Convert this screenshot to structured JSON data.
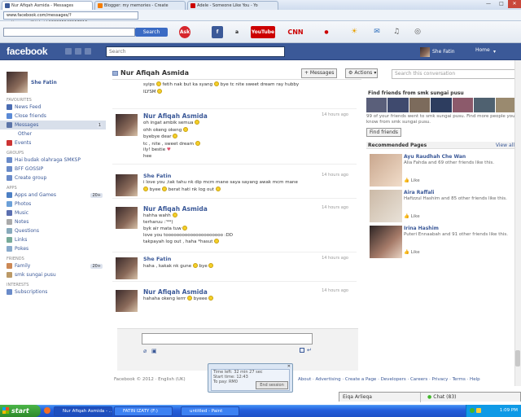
{
  "browser": {
    "tabs": [
      {
        "label": "Nur Afiqah Asmida - Messages",
        "icon_color": "#3b5998",
        "active": true
      },
      {
        "label": "Blogger: my memories - Create",
        "icon_color": "#f57d00",
        "active": false
      },
      {
        "label": "Adele - Someone Like You - Yo",
        "icon_color": "#cc0000",
        "active": false
      }
    ],
    "url": "www.facebook.com/messages/?action=read&tid=id.136305543157316",
    "search_button": "Search",
    "toolbar_icons": [
      {
        "name": "ask-icon",
        "label": "Ask",
        "color": "#d6262c"
      },
      {
        "name": "facebook-icon",
        "label": "f",
        "color": "#3b5998"
      },
      {
        "name": "amazon-icon",
        "label": "a",
        "color": "#222"
      },
      {
        "name": "youtube-icon",
        "label": "YouTube",
        "color": "#c00"
      },
      {
        "name": "cnn-icon",
        "label": "CNN",
        "color": "#c00"
      },
      {
        "name": "weather-icon",
        "label": "☀",
        "color": "#e8a000"
      },
      {
        "name": "mail-icon",
        "label": "✉",
        "color": "#2e6fbd"
      },
      {
        "name": "music-icon",
        "label": "♫",
        "color": "#555"
      }
    ]
  },
  "fb": {
    "logo": "facebook",
    "search_placeholder": "Search",
    "user_name": "She Fatin",
    "home": "Home"
  },
  "left": {
    "profile_name": "She Fatin",
    "favourites_heading": "FAVOURITES",
    "favourites": [
      {
        "label": "News Feed",
        "color": "#4a6cb3",
        "count": ""
      },
      {
        "label": "Close friends",
        "color": "#5a8ad6",
        "count": ""
      },
      {
        "label": "Messages",
        "color": "#5b74a8",
        "count": "1",
        "selected": true
      },
      {
        "label": "Other",
        "color": "",
        "count": ""
      },
      {
        "label": "Events",
        "color": "#c33",
        "count": ""
      }
    ],
    "groups_heading": "GROUPS",
    "groups": [
      {
        "label": "Hai budak olahraga SMKSP",
        "color": "#6a8bc9"
      },
      {
        "label": "BFF GOSSIP",
        "color": "#6a8bc9"
      },
      {
        "label": "Create group",
        "color": "#6a8bc9"
      }
    ],
    "apps_heading": "APPS",
    "apps": [
      {
        "label": "Apps and Games",
        "color": "#4c7fc4",
        "count": "20+"
      },
      {
        "label": "Photos",
        "color": "#6ca0d8",
        "count": ""
      },
      {
        "label": "Music",
        "color": "#5b6fb0",
        "count": ""
      },
      {
        "label": "Notes",
        "color": "#aaa",
        "count": ""
      },
      {
        "label": "Questions",
        "color": "#8ab",
        "count": ""
      },
      {
        "label": "Links",
        "color": "#7a9",
        "count": ""
      },
      {
        "label": "Pokes",
        "color": "#8ac",
        "count": ""
      }
    ],
    "friends_heading": "FRIENDS",
    "friends": [
      {
        "label": "Family",
        "color": "#c85",
        "count": "20+"
      },
      {
        "label": "smk sungai pusu",
        "color": "#b96",
        "count": ""
      }
    ],
    "interests_heading": "INTERESTS",
    "interests": [
      {
        "label": "Subscriptions",
        "color": "#6a8bc9"
      }
    ]
  },
  "conversation": {
    "title": "Nur Afiqah Asmida",
    "messages_button": "+ Messages",
    "actions_button": "Actions",
    "search_placeholder": "Search this conversation",
    "messages": [
      {
        "name": "",
        "time": "",
        "lines": [
          "syips 🙂 fetih nak but ka syang 🙂 bye tc nite sweet dream ray hubby",
          "",
          "ILYSM 🙂"
        ]
      },
      {
        "name": "Nur Afiqah Asmida",
        "time": "14 hours ago",
        "lines": [
          "oh ingat ambik semua 🙂",
          "ohh okeng okeng 🙂",
          "byebye dear 🙂",
          "tc , nite , sweet dream 🙂",
          "ily! bestie ♥",
          "hee"
        ]
      },
      {
        "name": "She Fatin",
        "time": "14 hours ago",
        "lines": [
          "i love you ,tak tahu nk dip mcm mane saya sayang awak mcm mane",
          "🙂 byee 🙂 berat hati nk log out 🙂"
        ]
      },
      {
        "name": "Nur Afiqah Asmida",
        "time": "14 hours ago",
        "lines": [
          "hahha wahh 🙂",
          "terharuu :'**)",
          "byk air mata tuw 🙂",
          "love you tooooooooooooooooooooo :DD",
          "takpayah log out , haha *hasut 🙂"
        ]
      },
      {
        "name": "She Fatin",
        "time": "14 hours ago",
        "lines": [
          "haha , kakak nk gune 🙂 bye 🙂"
        ]
      },
      {
        "name": "Nur Afiqah Asmida",
        "time": "14 hours ago",
        "lines": [
          "hahaha okeng lerrr 🙂 byeee 🙂"
        ]
      }
    ]
  },
  "right": {
    "find_friends_heading": "Find friends from smk sungai pusu",
    "find_friends_text": "99 of your friends went to smk sungai pusu. Find more people you know from smk sungai pusu.",
    "find_friends_button": "Find friends",
    "recommended_heading": "Recommended Pages",
    "view_all": "View all",
    "pages": [
      {
        "name": "Ayu Raudhah Che Wan",
        "desc": "Alia Fahda and 69 other friends like this.",
        "like": "Like"
      },
      {
        "name": "Aira Raffali",
        "desc": "Hafizzul Hashim and 85 other friends like this.",
        "like": "Like"
      },
      {
        "name": "Irina Hashim",
        "desc": "Puteri Ennaabah and 91 other friends like this.",
        "like": "Like"
      }
    ]
  },
  "footer": {
    "copyright": "Facebook © 2012 · English (UK)",
    "links": "About · Advertising · Create a Page · Developers · Careers · Privacy · Terms · Help"
  },
  "dialog": {
    "line1": "Time left: 32 min 27 sec",
    "line2": "Start time: 12:43",
    "line3": "To pay: RM0",
    "button": "End session"
  },
  "chat": {
    "name": "Eiqa Arlieqa",
    "chat_label": "Chat (83)"
  },
  "taskbar": {
    "start": "start",
    "tasks": [
      {
        "label": "Nur Afiqah Asmida - ..."
      },
      {
        "label": "FATIN IZATY (F:)"
      },
      {
        "label": "untitled - Paint"
      }
    ],
    "clock": "1:09 PM"
  }
}
